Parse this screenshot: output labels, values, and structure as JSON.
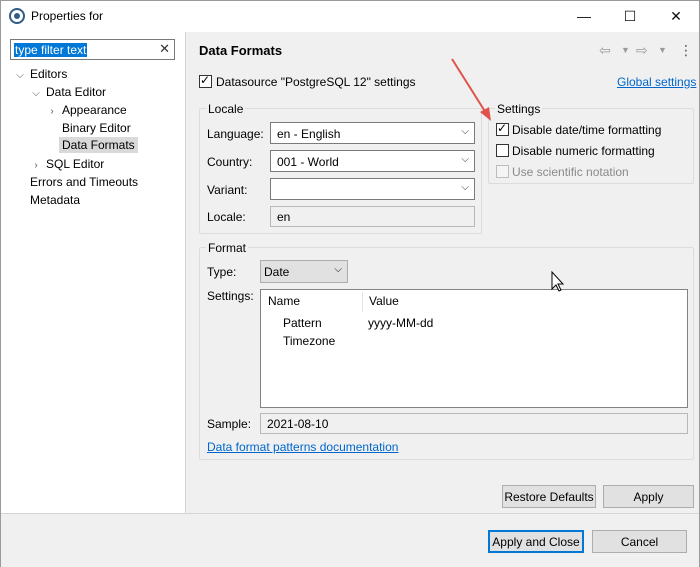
{
  "window": {
    "title": "Properties for",
    "minimize": "—",
    "maximize": "☐",
    "close": "✕"
  },
  "filter": {
    "value": "type filter text"
  },
  "tree": [
    {
      "label": "Editors"
    },
    {
      "label": "Data Editor"
    },
    {
      "label": "Appearance"
    },
    {
      "label": "Binary Editor"
    },
    {
      "label": "Data Formats"
    },
    {
      "label": "SQL Editor"
    },
    {
      "label": "Errors and Timeouts"
    },
    {
      "label": "Metadata"
    }
  ],
  "page": {
    "title": "Data Formats",
    "datasource_label": "Datasource \"PostgreSQL 12\" settings",
    "datasource_checked": true,
    "global_link": "Global settings"
  },
  "locale": {
    "title": "Locale",
    "language_label": "Language:",
    "language_value": "en - English",
    "country_label": "Country:",
    "country_value": "001 - World",
    "variant_label": "Variant:",
    "variant_value": "",
    "locale_label": "Locale:",
    "locale_value": "en"
  },
  "settings": {
    "title": "Settings",
    "disable_datetime": "Disable date/time formatting",
    "disable_numeric": "Disable numeric formatting",
    "scientific": "Use scientific notation"
  },
  "format": {
    "title": "Format",
    "type_label": "Type:",
    "type_value": "Date",
    "settings_label": "Settings:",
    "columns": [
      "Name",
      "Value"
    ],
    "rows": [
      {
        "name": "Pattern",
        "value": "yyyy-MM-dd"
      },
      {
        "name": "Timezone",
        "value": ""
      }
    ],
    "sample_label": "Sample:",
    "sample_value": "2021-08-10",
    "doc_link": "Data format patterns documentation"
  },
  "buttons": {
    "restore": "Restore Defaults",
    "apply": "Apply",
    "apply_close": "Apply and Close",
    "cancel": "Cancel"
  },
  "colors": {
    "accent": "#0078d7",
    "link": "#0066cc",
    "annotation_arrow": "#e0524a"
  }
}
